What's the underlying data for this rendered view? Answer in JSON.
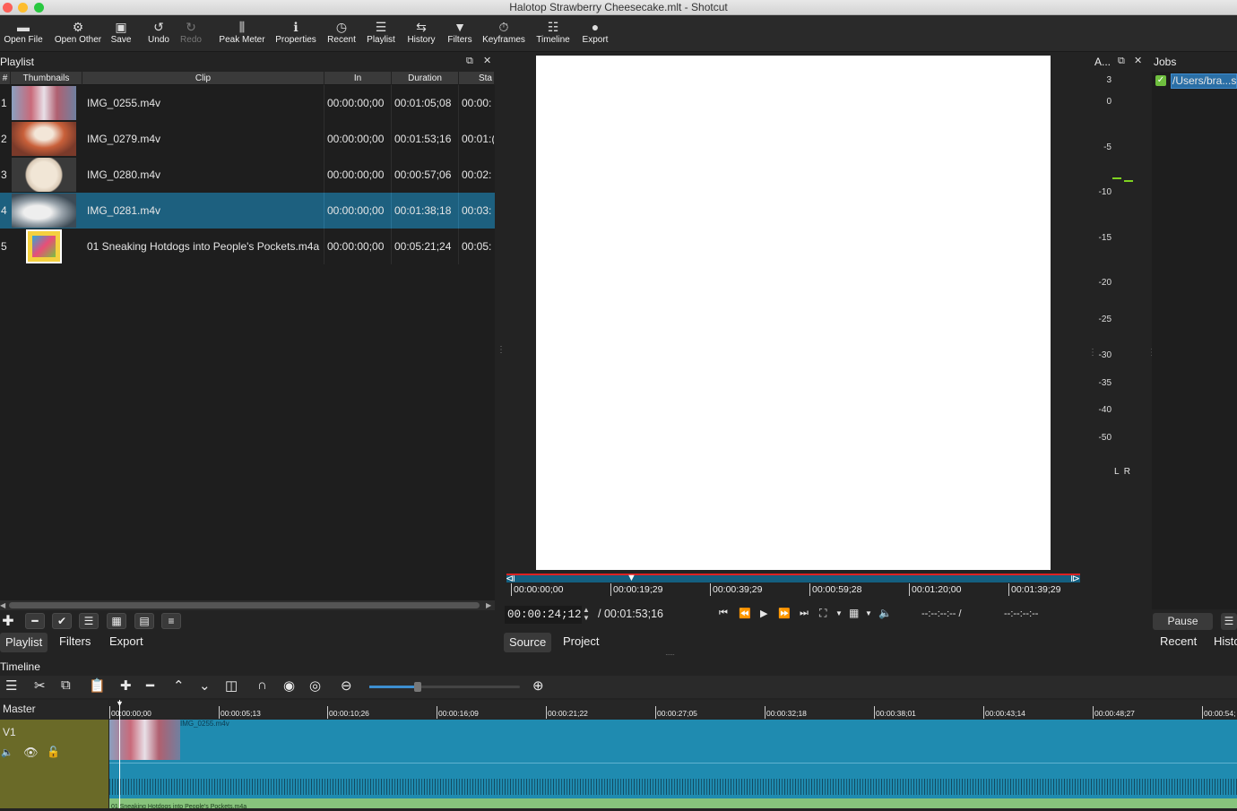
{
  "window": {
    "title": "Halotop Strawberry Cheesecake.mlt - Shotcut"
  },
  "toolbar": {
    "items": [
      {
        "label": "Open File",
        "icon": "open-file-icon",
        "glyph": "▬"
      },
      {
        "label": "Open Other",
        "icon": "open-other-icon",
        "glyph": "⚙"
      },
      {
        "label": "Save",
        "icon": "save-icon",
        "glyph": "▣"
      },
      {
        "label": "Undo",
        "icon": "undo-icon",
        "glyph": "↺"
      },
      {
        "label": "Redo",
        "icon": "redo-icon",
        "glyph": "↻"
      },
      {
        "label": "Peak Meter",
        "icon": "peak-meter-icon",
        "glyph": "⫼"
      },
      {
        "label": "Properties",
        "icon": "properties-icon",
        "glyph": "ℹ"
      },
      {
        "label": "Recent",
        "icon": "recent-icon",
        "glyph": "◷"
      },
      {
        "label": "Playlist",
        "icon": "playlist-icon",
        "glyph": "☰"
      },
      {
        "label": "History",
        "icon": "history-icon",
        "glyph": "⇆"
      },
      {
        "label": "Filters",
        "icon": "filters-icon",
        "glyph": "▼"
      },
      {
        "label": "Keyframes",
        "icon": "keyframes-icon",
        "glyph": "⏱"
      },
      {
        "label": "Timeline",
        "icon": "timeline-icon",
        "glyph": "☷"
      },
      {
        "label": "Export",
        "icon": "export-icon",
        "glyph": "●"
      }
    ]
  },
  "playlist": {
    "title": "Playlist",
    "columns": [
      "#",
      "Thumbnails",
      "Clip",
      "In",
      "Duration",
      "Sta"
    ],
    "rows": [
      {
        "num": "1",
        "clip": "IMG_0255.m4v",
        "in": "00:00:00;00",
        "duration": "00:01:05;08",
        "start": "00:00:"
      },
      {
        "num": "2",
        "clip": "IMG_0279.m4v",
        "in": "00:00:00;00",
        "duration": "00:01:53;16",
        "start": "00:01:("
      },
      {
        "num": "3",
        "clip": "IMG_0280.m4v",
        "in": "00:00:00;00",
        "duration": "00:00:57;06",
        "start": "00:02:"
      },
      {
        "num": "4",
        "clip": "IMG_0281.m4v",
        "in": "00:00:00;00",
        "duration": "00:01:38;18",
        "start": "00:03:"
      },
      {
        "num": "5",
        "clip": "01 Sneaking Hotdogs into People's Pockets.m4a",
        "in": "00:00:00;00",
        "duration": "00:05:21;24",
        "start": "00:05:"
      }
    ],
    "selected_row": "4",
    "tabs": [
      "Playlist",
      "Filters",
      "Export"
    ]
  },
  "player": {
    "ruler_ticks": [
      "00:00:00;00",
      "00:00:19;29",
      "00:00:39;29",
      "00:00:59;28",
      "00:01:20;00",
      "00:01:39;29"
    ],
    "current_time": "00:00:24;12",
    "total_time": "/ 00:01:53;16",
    "in_point": "--:--:--:-- /",
    "out_point": "--:--:--:--",
    "tabs": [
      "Source",
      "Project"
    ]
  },
  "audio_meter": {
    "title": "A...",
    "labels": [
      "3",
      "0",
      "-5",
      "-10",
      "-15",
      "-20",
      "-25",
      "-30",
      "-35",
      "-40",
      "-50"
    ],
    "channels": "L  R"
  },
  "jobs": {
    "title": "Jobs",
    "item": "/Users/bra...s",
    "pause_label": "Pause",
    "tabs": [
      "Recent",
      "Histo"
    ]
  },
  "timeline": {
    "title": "Timeline",
    "master_label": "Master",
    "track_name": "V1",
    "ruler": [
      "00:00:00;00",
      "00:00:05;13",
      "00:00:10;26",
      "00:00:16;09",
      "00:00:21;22",
      "00:00:27;05",
      "00:00:32;18",
      "00:00:38;01",
      "00:00:43;14",
      "00:00:48;27",
      "00:00:54;"
    ],
    "clip_label": "IMG_0255.m4v",
    "audio_clip_label": "01 Sneaking Hotdogs into People's Pockets.m4a"
  },
  "colors": {
    "selection": "#1d607f",
    "track": "#1f8bb0",
    "track_header": "#6a6a28"
  }
}
